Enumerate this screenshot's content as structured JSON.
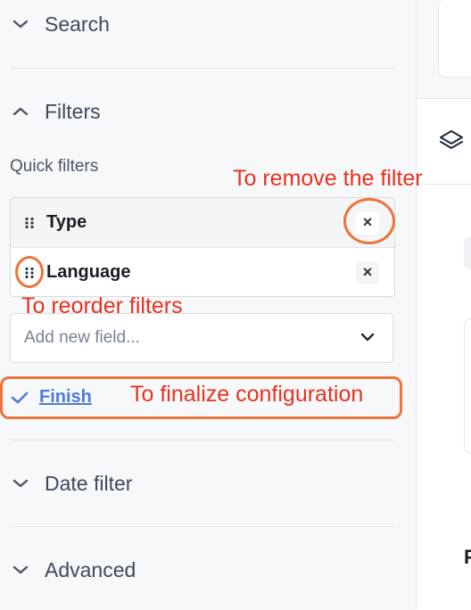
{
  "sidebar": {
    "sections": {
      "search": "Search",
      "filters": "Filters",
      "date_filter": "Date filter",
      "advanced": "Advanced"
    },
    "quick_filters_label": "Quick filters",
    "quick_filters": [
      {
        "label": "Type"
      },
      {
        "label": "Language"
      }
    ],
    "remove_icon": "×",
    "add_field": {
      "placeholder": "Add new field..."
    },
    "finish_label": "Finish"
  },
  "annotations": {
    "remove": "To remove the filter",
    "reorder": "To reorder filters",
    "finalize": "To finalize configuration"
  },
  "right_panel": {
    "letter": "F"
  },
  "colors": {
    "annotation_text": "#e5331f",
    "annotation_outline": "#ee7239",
    "link": "#4f7bd9"
  }
}
